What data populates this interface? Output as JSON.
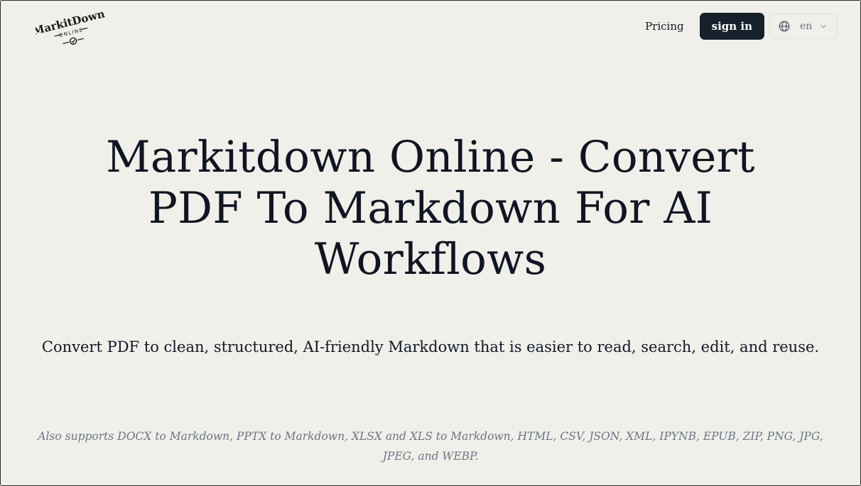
{
  "header": {
    "logo_text_top": "MarkitDown",
    "logo_text_bottom": "ONLINE",
    "nav": {
      "pricing_label": "Pricing",
      "signin_label": "sign in"
    },
    "language": {
      "icon": "globe-icon",
      "value": "en",
      "chevron_icon": "chevron-down-icon"
    }
  },
  "hero": {
    "title_lines": [
      "Markitdown Online - Convert",
      "PDF To Markdown For AI",
      "Workflows"
    ],
    "subtitle": "Convert PDF to clean, structured, AI-friendly Markdown that is easier to read, search, edit, and reuse.",
    "note": "Also supports DOCX to Markdown, PPTX to Markdown, XLSX and XLS to Markdown, HTML, CSV, JSON, XML, IPYNB, EPUB, ZIP, PNG, JPG, JPEG, and WEBP."
  },
  "colors": {
    "background": "#f0efe9",
    "primary_button": "#17212b",
    "text": "#0f1522",
    "muted": "#6b7587"
  }
}
